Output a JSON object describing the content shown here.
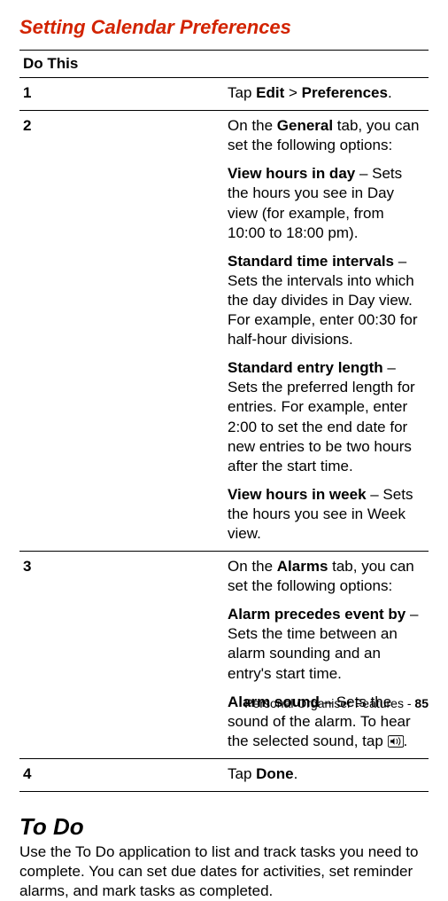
{
  "section_title": "Setting Calendar Preferences",
  "table_header": "Do This",
  "steps": [
    {
      "num": "1",
      "segments": [
        {
          "t": "Tap ",
          "cls": ""
        },
        {
          "t": "Edit",
          "cls": "cond"
        },
        {
          "t": " > ",
          "cls": ""
        },
        {
          "t": "Preferences",
          "cls": "cond"
        },
        {
          "t": ".",
          "cls": ""
        }
      ]
    }
  ],
  "step2": {
    "num": "2",
    "intro": [
      {
        "t": "On the ",
        "cls": ""
      },
      {
        "t": "General",
        "cls": "cond"
      },
      {
        "t": " tab, you can set the following options:",
        "cls": ""
      }
    ],
    "items": [
      {
        "label": "View hours in day",
        "desc": " – Sets the hours you see in Day view (for example, from 10:00 to 18:00 pm)."
      },
      {
        "label": "Standard time intervals",
        "desc": " – Sets the intervals into which the day divides in Day view. For example, enter 00:30 for half-hour divisions."
      },
      {
        "label": "Standard entry length",
        "desc": " – Sets the preferred length for entries. For example, enter 2:00 to set the end date for new entries to be two hours after the start time."
      },
      {
        "label": "View hours in week",
        "desc": " – Sets the hours you see in Week view."
      }
    ]
  },
  "step3": {
    "num": "3",
    "intro": [
      {
        "t": "On the ",
        "cls": ""
      },
      {
        "t": "Alarms",
        "cls": "cond"
      },
      {
        "t": " tab, you can set the following options:",
        "cls": ""
      }
    ],
    "items": [
      {
        "label": "Alarm precedes event by",
        "desc": " – Sets the time between an alarm sounding and an entry's start time."
      }
    ],
    "sound_label": "Alarm sound",
    "sound_desc_pre": " – Sets the sound of the alarm. To hear the selected sound, tap ",
    "sound_desc_post": "."
  },
  "step4": {
    "num": "4",
    "segments": [
      {
        "t": "Tap ",
        "cls": ""
      },
      {
        "t": "Done",
        "cls": "cond"
      },
      {
        "t": ".",
        "cls": ""
      }
    ]
  },
  "todo": {
    "title": "To Do",
    "text": "Use the To Do application to list and track tasks you need to complete. You can set due dates for activities, set reminder alarms, and mark tasks as completed."
  },
  "footer": {
    "label": "Personal Organiser Features - ",
    "page": "85"
  }
}
